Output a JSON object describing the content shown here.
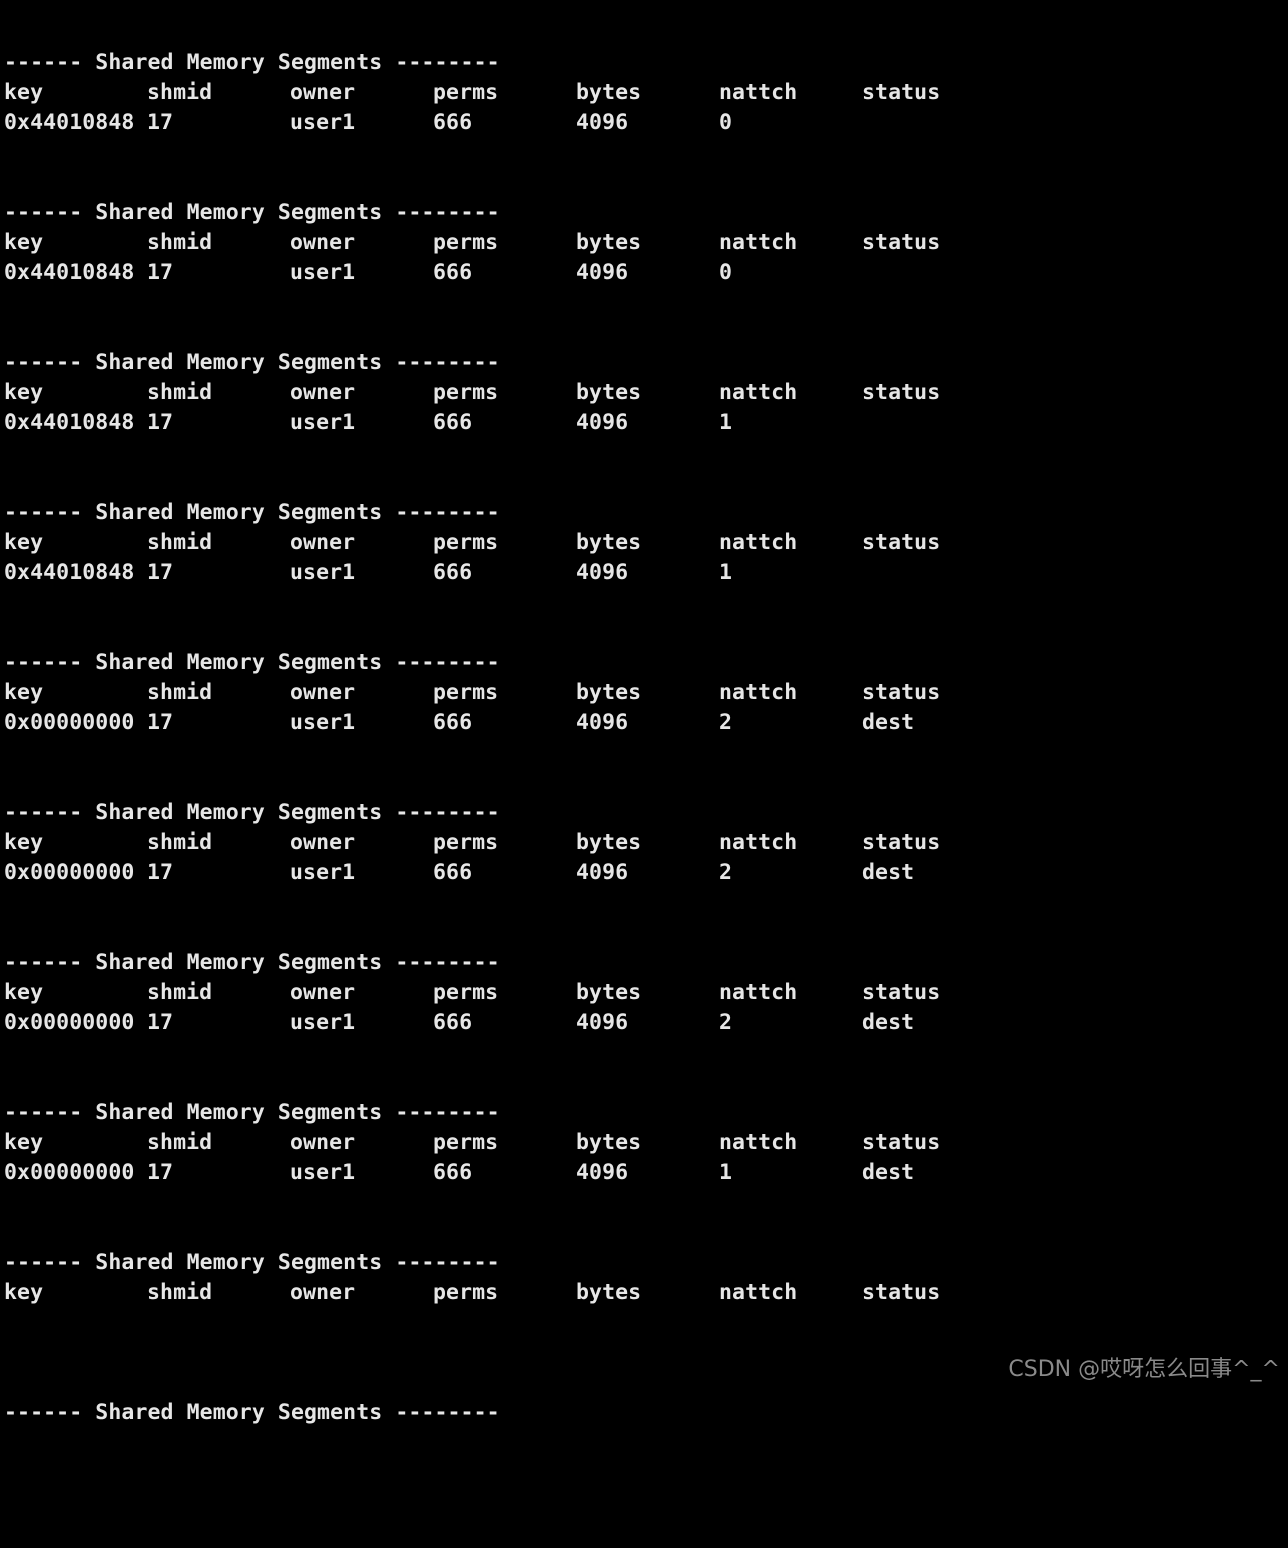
{
  "terminal": {
    "blocks": [
      {
        "title": "------ Shared Memory Segments --------",
        "headers": [
          "key",
          "shmid",
          "owner",
          "perms",
          "bytes",
          "nattch",
          "status"
        ],
        "row": [
          "0x44010848",
          "17",
          "user1",
          "666",
          "4096",
          "0",
          ""
        ]
      },
      {
        "title": "------ Shared Memory Segments --------",
        "headers": [
          "key",
          "shmid",
          "owner",
          "perms",
          "bytes",
          "nattch",
          "status"
        ],
        "row": [
          "0x44010848",
          "17",
          "user1",
          "666",
          "4096",
          "0",
          ""
        ]
      },
      {
        "title": "------ Shared Memory Segments --------",
        "headers": [
          "key",
          "shmid",
          "owner",
          "perms",
          "bytes",
          "nattch",
          "status"
        ],
        "row": [
          "0x44010848",
          "17",
          "user1",
          "666",
          "4096",
          "1",
          ""
        ]
      },
      {
        "title": "------ Shared Memory Segments --------",
        "headers": [
          "key",
          "shmid",
          "owner",
          "perms",
          "bytes",
          "nattch",
          "status"
        ],
        "row": [
          "0x44010848",
          "17",
          "user1",
          "666",
          "4096",
          "1",
          ""
        ]
      },
      {
        "title": "------ Shared Memory Segments --------",
        "headers": [
          "key",
          "shmid",
          "owner",
          "perms",
          "bytes",
          "nattch",
          "status"
        ],
        "row": [
          "0x00000000",
          "17",
          "user1",
          "666",
          "4096",
          "2",
          "dest"
        ]
      },
      {
        "title": "------ Shared Memory Segments --------",
        "headers": [
          "key",
          "shmid",
          "owner",
          "perms",
          "bytes",
          "nattch",
          "status"
        ],
        "row": [
          "0x00000000",
          "17",
          "user1",
          "666",
          "4096",
          "2",
          "dest"
        ]
      },
      {
        "title": "------ Shared Memory Segments --------",
        "headers": [
          "key",
          "shmid",
          "owner",
          "perms",
          "bytes",
          "nattch",
          "status"
        ],
        "row": [
          "0x00000000",
          "17",
          "user1",
          "666",
          "4096",
          "2",
          "dest"
        ]
      },
      {
        "title": "------ Shared Memory Segments --------",
        "headers": [
          "key",
          "shmid",
          "owner",
          "perms",
          "bytes",
          "nattch",
          "status"
        ],
        "row": [
          "0x00000000",
          "17",
          "user1",
          "666",
          "4096",
          "1",
          "dest"
        ]
      },
      {
        "title": "------ Shared Memory Segments --------",
        "headers": [
          "key",
          "shmid",
          "owner",
          "perms",
          "bytes",
          "nattch",
          "status"
        ],
        "row": null
      },
      {
        "title": "------ Shared Memory Segments --------",
        "headers": null,
        "row": null
      }
    ]
  },
  "watermark": "CSDN @哎呀怎么回事^_^",
  "colors": {
    "background": "#000000",
    "text": "#e6e6e6",
    "watermark": "#8a8a8a"
  }
}
